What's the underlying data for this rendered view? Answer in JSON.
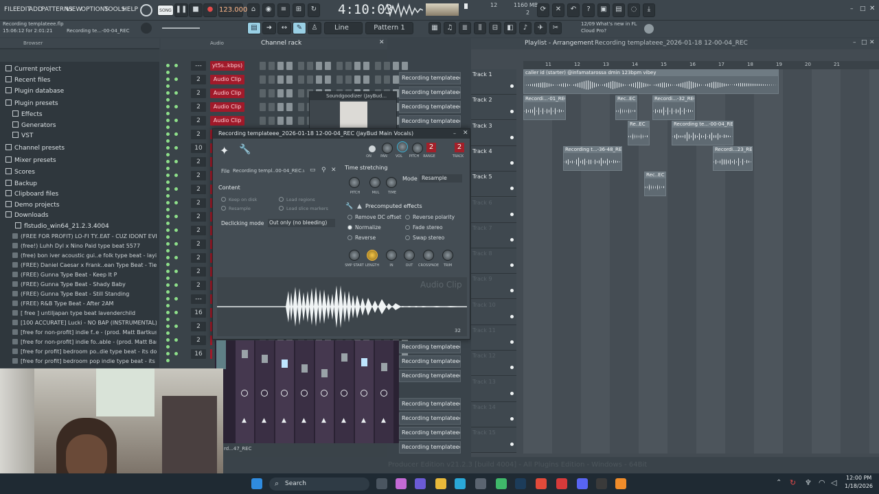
{
  "menu": {
    "file": "FILE",
    "edit": "EDIT",
    "add": "ADD",
    "patterns": "PATTERNS",
    "view": "VIEW",
    "options": "OPTIONS",
    "tools": "TOOLS",
    "help": "HELP"
  },
  "transport": {
    "song_label": "SONG",
    "tempo": "123.000",
    "time": "4:10:03",
    "cpu_num": "12",
    "mem": "1160 MB",
    "voices": "2"
  },
  "info": {
    "project_name": "Recording templateee.flp",
    "time_range": "15:06:12 for 2:01:21",
    "hint": "Recording te...-00-04_REC",
    "news_date": "12/09",
    "news_title": "What's new in FL",
    "news_sub": "Cloud Pro?"
  },
  "toolbar": {
    "line_mode": "Line",
    "pattern": "Pattern 1"
  },
  "browser": {
    "title": "Browser",
    "items": [
      {
        "label": "Current project",
        "kind": "folder"
      },
      {
        "label": "Recent files",
        "kind": "folder"
      },
      {
        "label": "Plugin database",
        "kind": "folder"
      },
      {
        "label": "Plugin presets",
        "kind": "folder"
      },
      {
        "label": "Effects",
        "kind": "folder"
      },
      {
        "label": "Generators",
        "kind": "folder"
      },
      {
        "label": "VST",
        "kind": "folder"
      },
      {
        "label": "Channel presets",
        "kind": "folder"
      },
      {
        "label": "Mixer presets",
        "kind": "folder"
      },
      {
        "label": "Scores",
        "kind": "folder"
      },
      {
        "label": "Backup",
        "kind": "folder"
      },
      {
        "label": "Clipboard files",
        "kind": "folder"
      },
      {
        "label": "Demo projects",
        "kind": "folder"
      },
      {
        "label": "Downloads",
        "kind": "folder"
      },
      {
        "label": "flstudio_win64_21.2.3.4004",
        "kind": "folder"
      },
      {
        "label": "(FREE FOR PROFIT) LO-FI TY..EAT - CUZ IDONT EVEN KNOW",
        "kind": "file"
      },
      {
        "label": "(free!) Luhh Dyl x Nino Paid type beat 5577",
        "kind": "file"
      },
      {
        "label": "(free) bon iver  acoustic gui..e folk type beat - laying here",
        "kind": "file"
      },
      {
        "label": "(FREE) Daniel Caesar x Frank..ean Type Beat - Tied To You",
        "kind": "file"
      },
      {
        "label": "(FREE) Gunna Type Beat - Keep It P",
        "kind": "file"
      },
      {
        "label": "(FREE) Gunna Type Beat - Shady Baby",
        "kind": "file"
      },
      {
        "label": "(FREE) Gunna Type Beat - Still Standing",
        "kind": "file"
      },
      {
        "label": "(FREE) R&B Type Beat - After 2AM",
        "kind": "file"
      },
      {
        "label": "[ free ] untiljapan type beat lavenderchild",
        "kind": "file"
      },
      {
        "label": "[100 ACCURATE] Lucki - NO BAP (INSTRUMENTAL)",
        "kind": "file"
      },
      {
        "label": "[free for non-profit] indie f..e - (prod. Matt Bartkus)",
        "kind": "file"
      },
      {
        "label": "[free for non-profit] indie fo..able - (prod. Matt Bartkus) (1)",
        "kind": "file"
      },
      {
        "label": "[free for profit] bedroom po..die type beat - its done (1)",
        "kind": "file"
      },
      {
        "label": "[free for profit] bedroom pop  indie type beat - its done",
        "kind": "file"
      }
    ]
  },
  "channel_rack": {
    "title": "Channel rack",
    "filter": "Audio",
    "rows": [
      {
        "num": "---",
        "clip": "yt5s..kbps)"
      },
      {
        "num": "2",
        "clip": "Audio Clip"
      },
      {
        "num": "2",
        "clip": "Audio Clip"
      },
      {
        "num": "2",
        "clip": "Audio Clip"
      },
      {
        "num": "2",
        "clip": "Audio Clip"
      },
      {
        "num": "2",
        "clip": "Audio Clip"
      },
      {
        "num": "10",
        "clip": ""
      },
      {
        "num": "2",
        "clip": ""
      },
      {
        "num": "2",
        "clip": ""
      },
      {
        "num": "2",
        "clip": ""
      },
      {
        "num": "2",
        "clip": ""
      },
      {
        "num": "2",
        "clip": ""
      },
      {
        "num": "2",
        "clip": ""
      },
      {
        "num": "2",
        "clip": ""
      },
      {
        "num": "2",
        "clip": ""
      },
      {
        "num": "2",
        "clip": ""
      },
      {
        "num": "2",
        "clip": ""
      },
      {
        "num": "---",
        "clip": ""
      },
      {
        "num": "16",
        "clip": ""
      },
      {
        "num": "2",
        "clip": ""
      },
      {
        "num": "2",
        "clip": ""
      },
      {
        "num": "16",
        "clip": ""
      }
    ],
    "bottom_label": "rd...47_REC"
  },
  "soundgoodizer": {
    "title": "Soundgoodizer (JayBud..."
  },
  "dialog": {
    "title": "Recording templateee_2026-01-18 12-00-04_REC (JayBud Main Vocals)",
    "file_label": "File",
    "file_value": "Recording templ..00-04_REC.wav",
    "content": "Content",
    "keep_on_disk": "Keep on disk",
    "resample_opt": "Resample",
    "load_regions": "Load regions",
    "load_slice": "Load slice markers",
    "declick_label": "Declicking mode",
    "declick_value": "Out only (no bleeding)",
    "ts_title": "Time stretching",
    "mode_label": "Mode",
    "mode_value": "Resample",
    "knob_pitch": "PITCH",
    "knob_mul": "MUL",
    "knob_time": "TIME",
    "pre_title": "Precomputed effects",
    "fx": [
      "Remove DC offset",
      "Normalize",
      "Reverse",
      "Reverse polarity",
      "Fade stereo",
      "Swap stereo"
    ],
    "fx_knobs": [
      "SMP START",
      "LENGTH",
      "IN",
      "OUT",
      "CROSSFADE",
      "TRIM"
    ],
    "head_knobs": [
      "ON",
      "PAN",
      "VOL",
      "PITCH",
      "RANGE",
      "TRACK"
    ],
    "range": "2",
    "track": "2",
    "watermark": "Audio Clip",
    "zoom": "32"
  },
  "rec_list": {
    "label": "Recording templateee_2..."
  },
  "playlist": {
    "title": "Playlist - Arrangement",
    "crumb": "Recording templateee_2026-01-18 12-00-04_REC",
    "ruler": [
      "11",
      "12",
      "13",
      "14",
      "15",
      "16",
      "17",
      "18",
      "19",
      "20",
      "21"
    ],
    "tracks": [
      "Track 1",
      "Track 2",
      "Track 3",
      "Track 4",
      "Track 5",
      "Track 6",
      "Track 7",
      "Track 8",
      "Track 9",
      "Track 10",
      "Track 11",
      "Track 12",
      "Track 13",
      "Track 14",
      "Track 15"
    ],
    "clips": {
      "t1": "caller id (starter) @infamatarossa dmin 123bpm vibey",
      "t2a": "Recordi...-01_REC",
      "t2b": "Rec..EC",
      "t2c": "Recordi...-32_REC",
      "t3a": "Re..EC",
      "t3b": "Recording te...-00-04_REC",
      "t4a": "Recording t...-36-48_REC",
      "t4b": "Recordi...23_REC",
      "t5": "Rec..EC"
    }
  },
  "status": {
    "edition": "Producer Edition v21.2.3 [build 4004] - All Plugins Edition - Windows - 64Bit"
  },
  "taskbar": {
    "search": "Search",
    "time": "12:00 PM",
    "date": "1/18/2026"
  }
}
